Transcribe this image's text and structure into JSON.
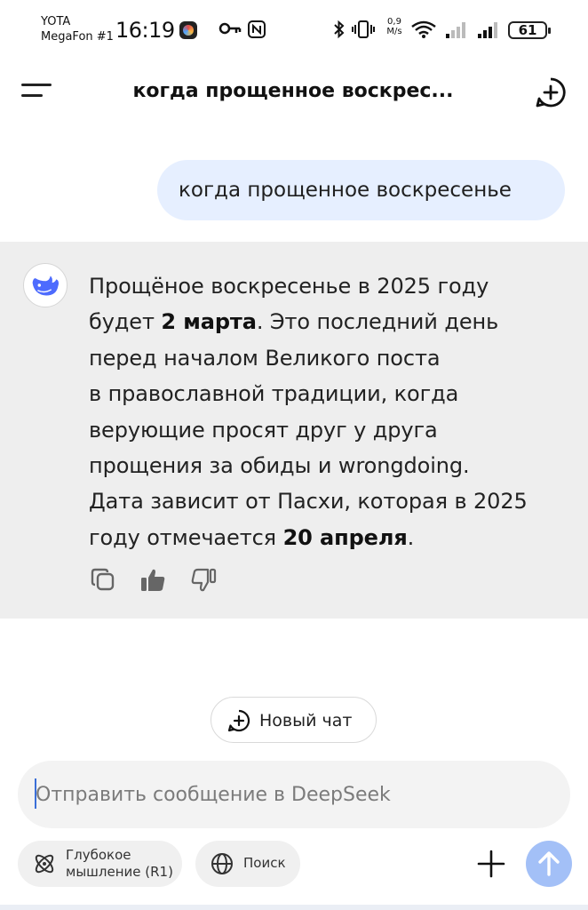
{
  "status_bar": {
    "carrier_top": "YOTA",
    "carrier_bottom": "MegaFon #1",
    "time": "16:19",
    "speed_value": "0,9",
    "speed_unit": "M/s",
    "battery": "61"
  },
  "header": {
    "title": "когда прощенное воскрес..."
  },
  "user_message": "когда прощенное воскресенье",
  "assistant_message": {
    "lines": [
      [
        "Прощёное воскресенье в 2025 году"
      ],
      [
        "будет ",
        "2 марта",
        ". Это последний день"
      ],
      [
        "перед началом Великого поста"
      ],
      [
        "в православной традиции, когда"
      ],
      [
        "верующие просят друг у друга"
      ],
      [
        "прощения за обиды и wrongdoing."
      ],
      [
        "Дата зависит от Пасхи, которая в 2025"
      ],
      [
        "году отмечается ",
        "20 апреля",
        "."
      ]
    ]
  },
  "new_chat_button": "Новый чат",
  "input": {
    "placeholder": "Отправить сообщение в DeepSeek",
    "value": ""
  },
  "toolbar": {
    "deep_think_line1": "Глубокое",
    "deep_think_line2": "мышление (R1)",
    "search_label": "Поиск"
  },
  "colors": {
    "accent": "#4d6bfe",
    "user_bubble": "#e6efff",
    "assistant_bg": "#eeeeee",
    "send_button": "#a3c0f7"
  },
  "icons": {
    "menu": "menu-icon",
    "new_chat": "plus-circle-icon",
    "avatar": "deepseek-whale-icon",
    "copy": "copy-icon",
    "like": "thumbs-up-icon",
    "dislike": "thumbs-down-icon",
    "deep_think": "atom-icon",
    "search": "globe-icon",
    "attach": "plus-icon",
    "send": "arrow-up-icon"
  }
}
